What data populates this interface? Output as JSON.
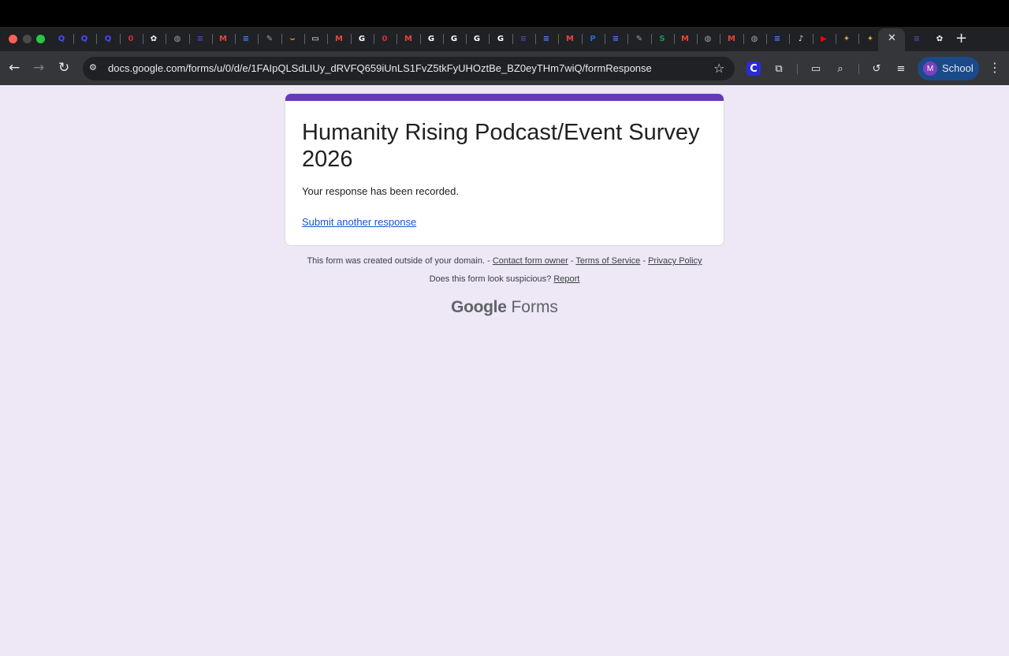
{
  "browser": {
    "tabs": {
      "active_close_glyph": "✕",
      "new_tab_glyph": "+",
      "favicons": [
        {
          "icon": "quip-icon",
          "glyph": "Q",
          "color": "#4a4aff"
        },
        {
          "icon": "quip-icon",
          "glyph": "Q",
          "color": "#4a4aff"
        },
        {
          "icon": "quip-icon",
          "glyph": "Q",
          "color": "#4a4aff"
        },
        {
          "icon": "opera-icon",
          "glyph": "0",
          "color": "#d32f2f"
        },
        {
          "icon": "app-icon",
          "glyph": "✿",
          "color": "#ffffff"
        },
        {
          "icon": "globe-icon",
          "glyph": "◍",
          "color": "#9aa0a6"
        },
        {
          "icon": "forms-icon",
          "glyph": "≡",
          "color": "#673ab7"
        },
        {
          "icon": "gmail-icon",
          "glyph": "M",
          "color": "#ea4335"
        },
        {
          "icon": "docs-icon",
          "glyph": "≡",
          "color": "#4285f4"
        },
        {
          "icon": "chat-icon",
          "glyph": "✎",
          "color": "#9aa0a6"
        },
        {
          "icon": "amazon-icon",
          "glyph": "⌣",
          "color": "#ff9900"
        },
        {
          "icon": "image-icon",
          "glyph": "▭",
          "color": "#ffffff"
        },
        {
          "icon": "gmail-icon",
          "glyph": "M",
          "color": "#ea4335"
        },
        {
          "icon": "google-icon",
          "glyph": "G",
          "color": "#ffffff"
        },
        {
          "icon": "opera-icon",
          "glyph": "0",
          "color": "#d32f2f"
        },
        {
          "icon": "gmail-icon",
          "glyph": "M",
          "color": "#ea4335"
        },
        {
          "icon": "google-icon",
          "glyph": "G",
          "color": "#ffffff"
        },
        {
          "icon": "google-icon",
          "glyph": "G",
          "color": "#ffffff"
        },
        {
          "icon": "google-icon",
          "glyph": "G",
          "color": "#ffffff"
        },
        {
          "icon": "google-icon",
          "glyph": "G",
          "color": "#ffffff"
        },
        {
          "icon": "forms-icon",
          "glyph": "≡",
          "color": "#673ab7"
        },
        {
          "icon": "docs-icon",
          "glyph": "≡",
          "color": "#4285f4"
        },
        {
          "icon": "gmail-icon",
          "glyph": "M",
          "color": "#ea4335"
        },
        {
          "icon": "paypal-icon",
          "glyph": "P",
          "color": "#1e6fd9"
        },
        {
          "icon": "docs-icon",
          "glyph": "≡",
          "color": "#4285f4"
        },
        {
          "icon": "chat-icon",
          "glyph": "✎",
          "color": "#9aa0a6"
        },
        {
          "icon": "sheets-icon",
          "glyph": "S",
          "color": "#0f9d58"
        },
        {
          "icon": "gmail-icon",
          "glyph": "M",
          "color": "#ea4335"
        },
        {
          "icon": "globe-icon",
          "glyph": "◍",
          "color": "#9aa0a6"
        },
        {
          "icon": "gmail-icon",
          "glyph": "M",
          "color": "#ea4335"
        },
        {
          "icon": "globe-icon",
          "glyph": "◍",
          "color": "#9aa0a6"
        },
        {
          "icon": "docs-icon",
          "glyph": "≡",
          "color": "#4285f4"
        },
        {
          "icon": "speaker-icon",
          "glyph": "♪",
          "color": "#e8eaed"
        },
        {
          "icon": "youtube-icon",
          "glyph": "▶",
          "color": "#ff0000"
        },
        {
          "icon": "copilot-icon",
          "glyph": "✦",
          "color": "#e0a030"
        },
        {
          "icon": "copilot-icon",
          "glyph": "✦",
          "color": "#e0a030"
        }
      ],
      "after_active": [
        {
          "icon": "forms-icon",
          "glyph": "≡",
          "color": "#673ab7"
        },
        {
          "icon": "app-icon",
          "glyph": "✿",
          "color": "#ffffff"
        }
      ]
    },
    "toolbar": {
      "back_glyph": "←",
      "forward_glyph": "→",
      "reload_glyph": "↻",
      "site_info_glyph": "⚙",
      "url": "docs.google.com/forms/u/0/d/e/1FAIpQLSdLIUy_dRVFQ659iUnLS1FvZ5tkFyUHOztBe_BZ0eyTHm7wiQ/formResponse",
      "star_glyph": "☆",
      "extension_c": "C",
      "extensions_glyph": "⧉",
      "cast_glyph": "▭",
      "lens_glyph": "⌕",
      "sync_glyph": "↺",
      "media_glyph": "≡",
      "profile_initial": "M",
      "profile_name": "School",
      "menu_glyph": "⋮"
    }
  },
  "form": {
    "accent_color": "#673ab7",
    "title": "Humanity Rising Podcast/Event Survey 2026",
    "confirmation": "Your response has been recorded.",
    "submit_another": "Submit another response"
  },
  "footer": {
    "domain_notice": "This form was created outside of your domain. - ",
    "contact_owner": "Contact form owner",
    "sep": " - ",
    "terms": "Terms of Service",
    "privacy": "Privacy Policy",
    "suspicious": "Does this form look suspicious? ",
    "report": "Report",
    "brand_google": "Google",
    "brand_forms": "Forms"
  }
}
